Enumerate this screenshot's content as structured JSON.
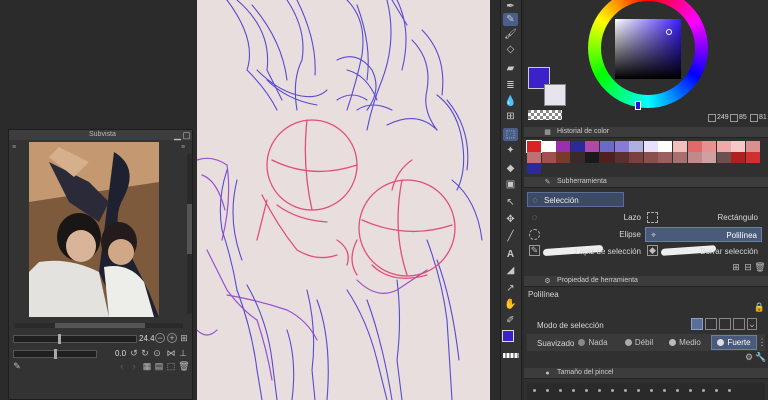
{
  "subvista": {
    "title": "Subvista",
    "zoom_value": "24.4",
    "rotation_value": "0.0"
  },
  "color_wheel": {
    "values": [
      "249",
      "85",
      "81"
    ],
    "main_color": "#3a22c8",
    "sub_color": "#e8e4ee"
  },
  "color_history": {
    "title": "Historial de color",
    "swatches": [
      "#d92424",
      "#ffffff",
      "#9a30b0",
      "#2a2a9a",
      "#b04aa8",
      "#6a6ac8",
      "#8a7ad8",
      "#b0b0e0",
      "#e8e0ff",
      "#ffffff",
      "#f3c0c0",
      "#e06a6a",
      "#e89090",
      "#f0a8a8",
      "#f6c8c8",
      "#d89090",
      "#c07070",
      "#a05050",
      "#7a3a2a",
      "#3a2a2a",
      "#1a1a1a",
      "#502020",
      "#5a3030",
      "#7a4040",
      "#8a5050",
      "#9a6060",
      "#a87070",
      "#c08a8a",
      "#d0a0a0",
      "#6a5050",
      "#b02020",
      "#d03030",
      "#2a2a9a"
    ]
  },
  "subtool": {
    "title": "Subherramienta",
    "group": "Selección",
    "items": [
      "Lazo",
      "Rectángulo",
      "Elipse",
      "Polilínea",
      "Lápiz de selección",
      "Borrar selección"
    ]
  },
  "tool_property": {
    "title": "Propiedad de herramienta",
    "tool_name": "Polilínea",
    "selection_mode_label": "Modo de selección",
    "smoothing_label": "Suavizado",
    "smoothing_options": [
      "Nada",
      "Débil",
      "Medio",
      "Fuerte"
    ]
  },
  "brush_size": {
    "title": "Tamaño del pincel"
  },
  "canvas": {
    "background": "#e8dede"
  }
}
